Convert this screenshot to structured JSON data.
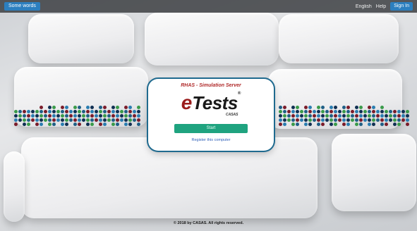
{
  "topbar": {
    "left_button": "Some words",
    "language": "English",
    "help": "Help",
    "signin": "Sign In"
  },
  "card": {
    "title": "RHAS - Simulation Server",
    "logo_e": "e",
    "logo_tests": "Tests",
    "logo_reg": "®",
    "logo_casas": "CASAS",
    "start_button": "Start",
    "register_link": "Register this computer"
  },
  "footer": {
    "copyright": "© 2018 by CASAS. All rights reserved."
  },
  "colors": {
    "brand_blue": "#2c7fbf",
    "card_border": "#1f6a8f",
    "start_green": "#1fa37f",
    "title_red": "#b02a2a",
    "dot_palette": [
      "#1f5f86",
      "#2a7db0",
      "#3a9a4a",
      "#7a1c2a",
      "#0f2f52"
    ]
  }
}
